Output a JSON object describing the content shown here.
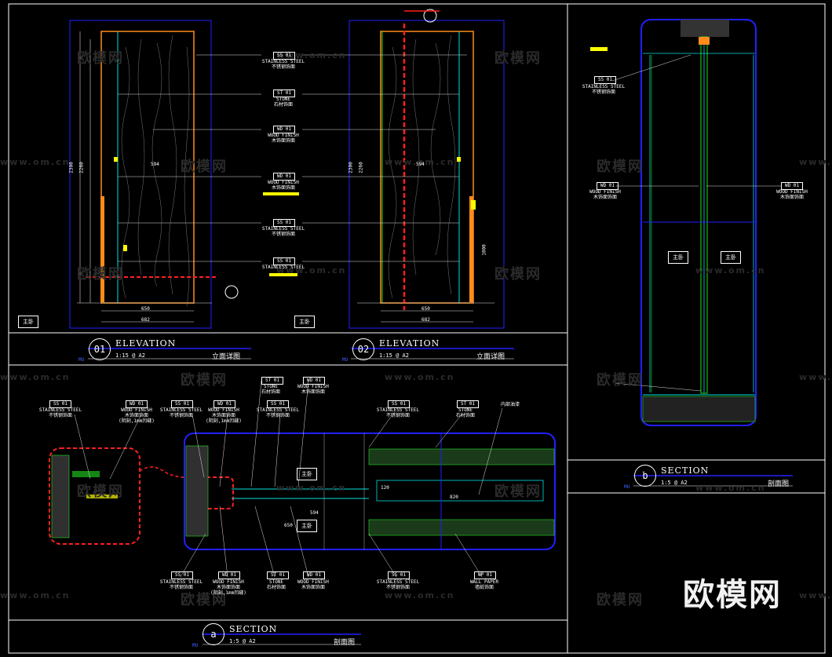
{
  "watermarks": {
    "brand": "欧模网",
    "site": "www.om.cn",
    "big": "欧模网"
  },
  "titles": {
    "elev1": {
      "num": "01",
      "name": "ELEVATION",
      "scale": "1:15 @ A2",
      "cn": "立面详图",
      "code": "MU"
    },
    "elev2": {
      "num": "02",
      "name": "ELEVATION",
      "scale": "1:15 @ A2",
      "cn": "立面详图",
      "code": "MU"
    },
    "secb": {
      "num": "b",
      "name": "SECTION",
      "scale": "1:5 @ A2",
      "cn": "剖面图",
      "code": "MU"
    },
    "seca": {
      "num": "a",
      "name": "SECTION",
      "scale": "1:5 @ A2",
      "cn": "剖面图",
      "code": "MU"
    }
  },
  "rooms": {
    "main": "主卧"
  },
  "callouts": {
    "ss_en": "STAINLESS STEEL",
    "ss_cn": "不锈钢饰面",
    "stone_en": "STONE",
    "stone_cn": "石材饰面",
    "wood_en": "WOOD FINISH",
    "wood_cn": "木饰面饰面",
    "wood_sub": "(阴刻,1mm凹缝)",
    "wall_en": "WALL PAPER",
    "wall_cn": "墙纸饰面",
    "inner": "内部油漆",
    "tag_ss": "SS 01",
    "tag_st": "ST 01",
    "tag_wd": "WD 01",
    "tag_wp": "WP 01"
  },
  "dims": {
    "h2300": "2300",
    "h2260": "2260",
    "w650": "650",
    "w682": "682",
    "w594": "594",
    "w1000": "1000",
    "d120": "120",
    "d820": "820"
  },
  "colors": {
    "bg": "#000000",
    "frame": "#ffffff",
    "blue": "#2020ff",
    "red": "#ff2020",
    "orange": "#ff8c1a",
    "cyan": "#00e0e0",
    "green": "#20e020",
    "yellow": "#ffff00"
  }
}
